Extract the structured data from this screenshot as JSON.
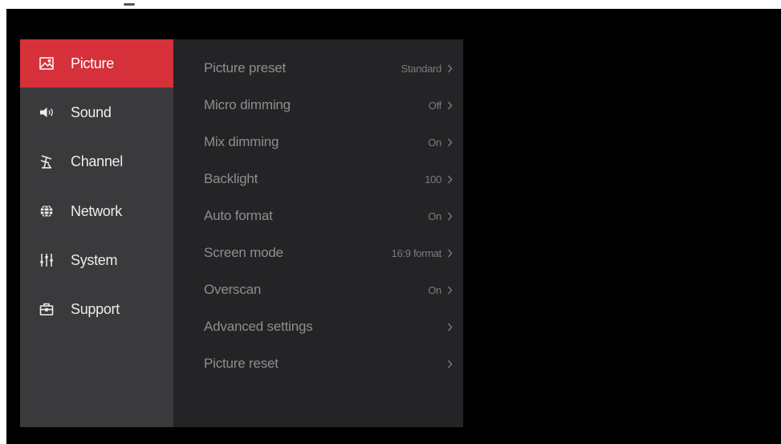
{
  "sidebar": {
    "items": [
      {
        "label": "Picture",
        "icon": "picture-icon",
        "active": true
      },
      {
        "label": "Sound",
        "icon": "speaker-icon",
        "active": false
      },
      {
        "label": "Channel",
        "icon": "antenna-icon",
        "active": false
      },
      {
        "label": "Network",
        "icon": "globe-icon",
        "active": false
      },
      {
        "label": "System",
        "icon": "sliders-icon",
        "active": false
      },
      {
        "label": "Support",
        "icon": "toolbox-icon",
        "active": false
      }
    ]
  },
  "picture_settings": {
    "items": [
      {
        "label": "Picture preset",
        "value": "Standard"
      },
      {
        "label": "Micro dimming",
        "value": "Off"
      },
      {
        "label": "Mix dimming",
        "value": "On"
      },
      {
        "label": "Backlight",
        "value": "100"
      },
      {
        "label": "Auto format",
        "value": "On"
      },
      {
        "label": "Screen mode",
        "value": "16:9 format"
      },
      {
        "label": "Overscan",
        "value": "On"
      },
      {
        "label": "Advanced settings",
        "value": ""
      },
      {
        "label": "Picture reset",
        "value": ""
      }
    ]
  },
  "colors": {
    "accent": "#d6303a",
    "sidebar_bg": "#3a3a3d",
    "panel_bg": "#242426",
    "screen_bg": "#000000"
  }
}
